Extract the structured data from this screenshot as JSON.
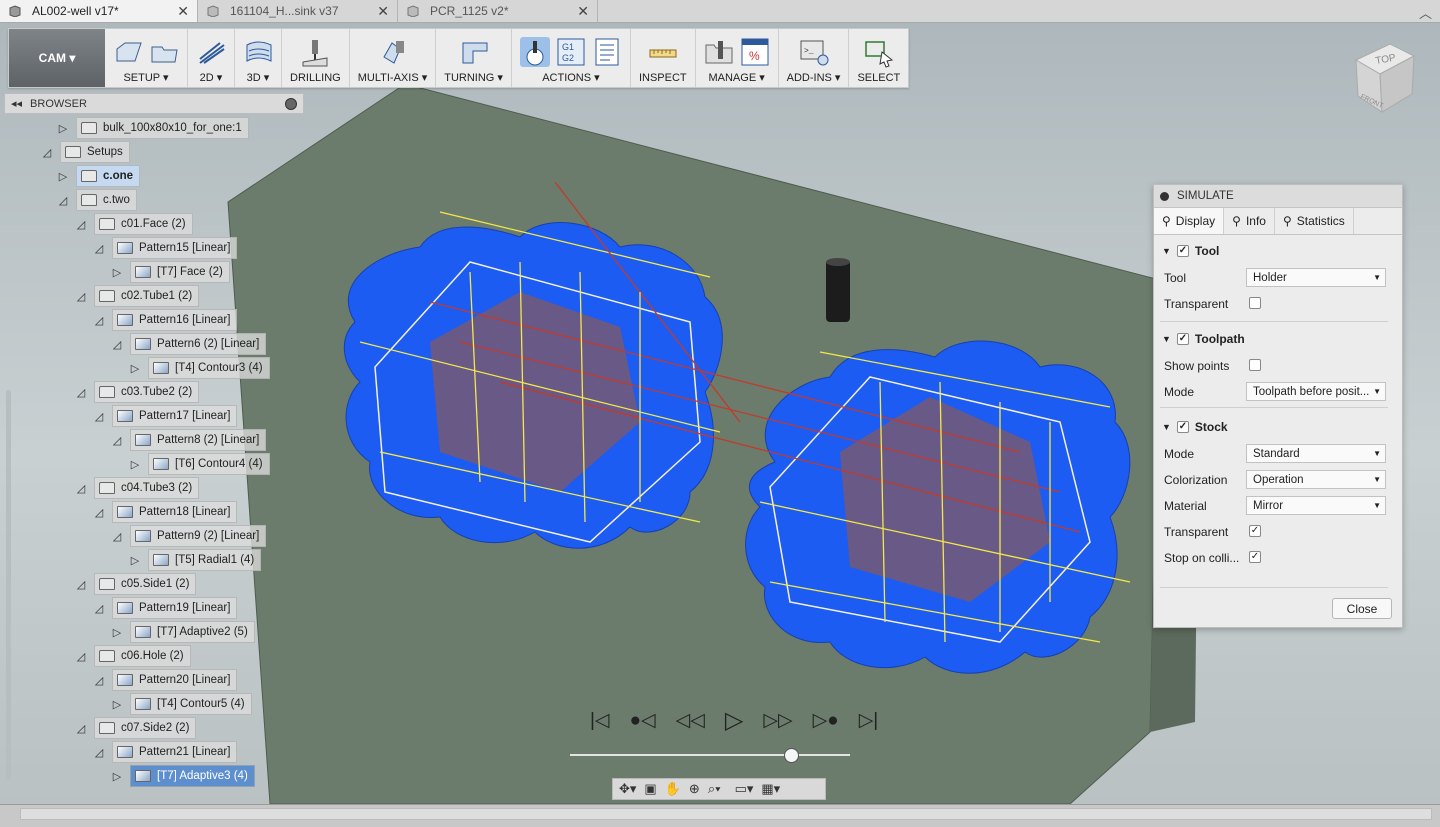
{
  "tabs": [
    {
      "label": "AL002-well v17*",
      "active": true
    },
    {
      "label": "161104_H...sink v37",
      "active": false
    },
    {
      "label": "PCR_1125 v2*",
      "active": false
    }
  ],
  "workspace": {
    "label": "CAM ▾"
  },
  "toolbar": [
    {
      "label": "SETUP ▾",
      "icons": [
        "setup-icon",
        "setup-folder-icon"
      ]
    },
    {
      "label": "2D ▾",
      "icons": [
        "2d-icon"
      ]
    },
    {
      "label": "3D ▾",
      "icons": [
        "3d-icon"
      ]
    },
    {
      "label": "DRILLING",
      "icons": [
        "drill-icon"
      ]
    },
    {
      "label": "MULTI-AXIS ▾",
      "icons": [
        "multi-axis-icon"
      ]
    },
    {
      "label": "TURNING ▾",
      "icons": [
        "turning-icon"
      ]
    },
    {
      "label": "ACTIONS ▾",
      "icons": [
        "simulate-icon",
        "g1g2-icon",
        "setup-sheet-icon"
      ]
    },
    {
      "label": "INSPECT",
      "icons": [
        "measure-icon"
      ]
    },
    {
      "label": "MANAGE ▾",
      "icons": [
        "tool-library-icon",
        "post-library-icon"
      ]
    },
    {
      "label": "ADD-INS ▾",
      "icons": [
        "scripts-icon"
      ]
    },
    {
      "label": "SELECT",
      "icons": [
        "select-icon"
      ]
    }
  ],
  "browser": {
    "title": "BROWSER",
    "nodes": [
      {
        "label": "bulk_100x80x10_for_one:1",
        "tri": "▷"
      },
      {
        "label": "Setups",
        "tri": "◿"
      },
      {
        "label": "c.one",
        "tri": "▷"
      },
      {
        "label": "c.two",
        "tri": "◿"
      },
      {
        "label": "c01.Face (2)",
        "tri": "◿"
      },
      {
        "label": "Pattern15 [Linear]",
        "tri": "◿"
      },
      {
        "label": "[T7] Face (2)",
        "tri": "▷"
      },
      {
        "label": "c02.Tube1 (2)",
        "tri": "◿"
      },
      {
        "label": "Pattern16 [Linear]",
        "tri": "◿"
      },
      {
        "label": "Pattern6 (2) [Linear]",
        "tri": "◿"
      },
      {
        "label": "[T4] Contour3 (4)",
        "tri": "▷"
      },
      {
        "label": "c03.Tube2 (2)",
        "tri": "◿"
      },
      {
        "label": "Pattern17 [Linear]",
        "tri": "◿"
      },
      {
        "label": "Pattern8 (2) [Linear]",
        "tri": "◿"
      },
      {
        "label": "[T6] Contour4 (4)",
        "tri": "▷"
      },
      {
        "label": "c04.Tube3 (2)",
        "tri": "◿"
      },
      {
        "label": "Pattern18 [Linear]",
        "tri": "◿"
      },
      {
        "label": "Pattern9 (2) [Linear]",
        "tri": "◿"
      },
      {
        "label": "[T5] Radial1 (4)",
        "tri": "▷"
      },
      {
        "label": "c05.Side1 (2)",
        "tri": "◿"
      },
      {
        "label": "Pattern19 [Linear]",
        "tri": "◿"
      },
      {
        "label": "[T7] Adaptive2 (5)",
        "tri": "▷"
      },
      {
        "label": "c06.Hole (2)",
        "tri": "◿"
      },
      {
        "label": "Pattern20 [Linear]",
        "tri": "◿"
      },
      {
        "label": "[T4] Contour5 (4)",
        "tri": "▷"
      },
      {
        "label": "c07.Side2 (2)",
        "tri": "◿"
      },
      {
        "label": "Pattern21 [Linear]",
        "tri": "◿"
      },
      {
        "label": "[T7] Adaptive3 (4)",
        "tri": "▷"
      }
    ]
  },
  "simulate": {
    "title": "SIMULATE",
    "tabs": [
      "Display",
      "Info",
      "Statistics"
    ],
    "tool_section": "Tool",
    "tool_label": "Tool",
    "tool_value": "Holder",
    "transparent_label": "Transparent",
    "toolpath_section": "Toolpath",
    "show_points_label": "Show points",
    "mode_label": "Mode",
    "toolpath_mode_value": "Toolpath before posit...",
    "stock_section": "Stock",
    "stock_mode_value": "Standard",
    "colorization_label": "Colorization",
    "colorization_value": "Operation",
    "material_label": "Material",
    "material_value": "Mirror",
    "stop_label": "Stop on colli...",
    "close_label": "Close"
  },
  "viewcube": {
    "top": "TOP",
    "front": "FRONT"
  },
  "colors": {
    "stock": "#1d5cf2",
    "toolpath_yellow": "#f4e84a",
    "toolpath_red": "#c33a2a",
    "plate": "#6a7c6c"
  }
}
